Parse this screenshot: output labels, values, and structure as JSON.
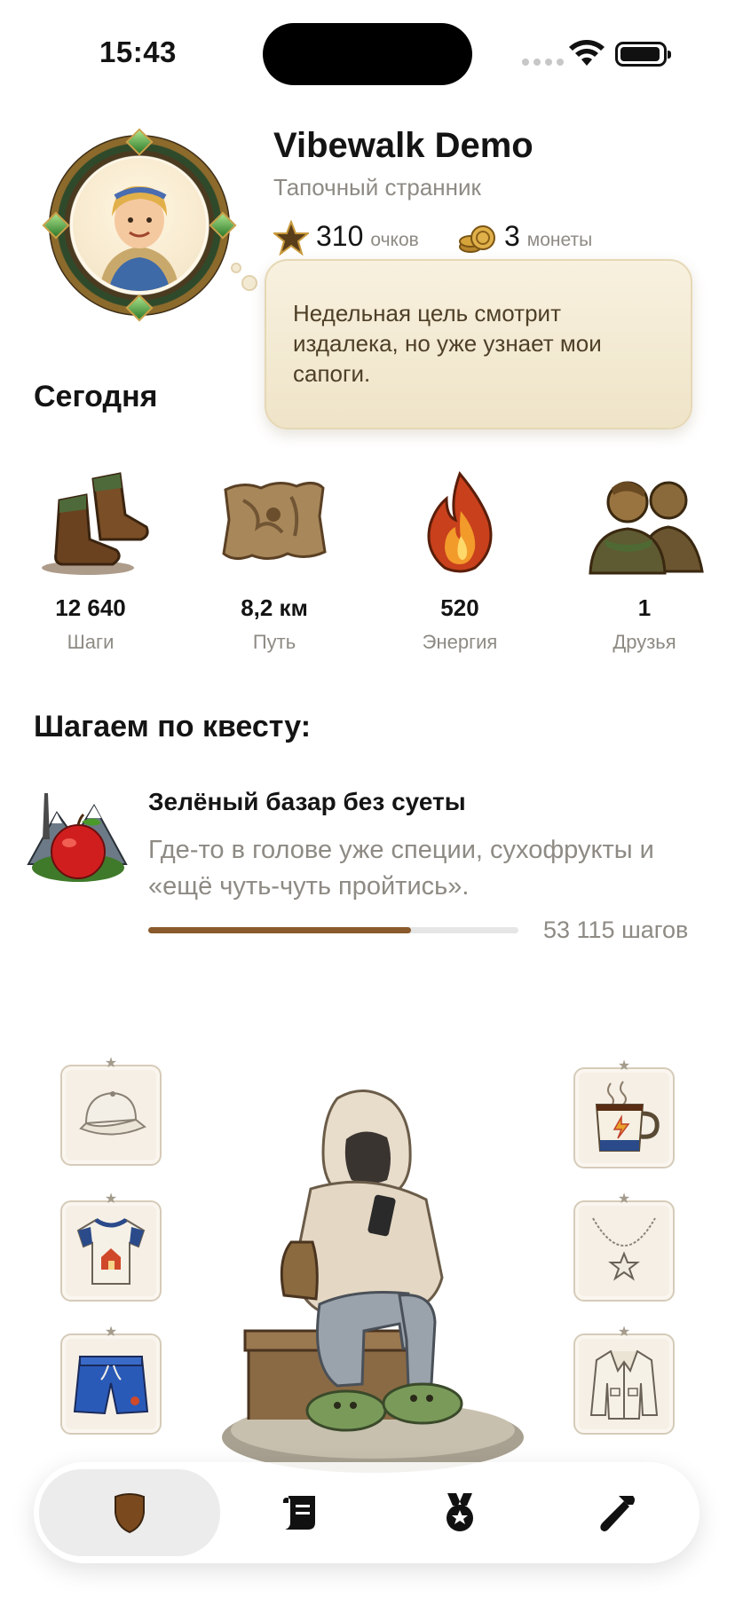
{
  "status_bar": {
    "time": "15:43"
  },
  "profile": {
    "name": "Vibewalk Demo",
    "title": "Тапочный странник",
    "points": "310",
    "points_unit": "очков",
    "coins": "3",
    "coins_unit": "монеты",
    "avatar_icon": "hero-portrait-icon"
  },
  "speech_bubble": {
    "text": "Недельная цель смотрит издалека, но уже узнает мои сапоги."
  },
  "today": {
    "title": "Сегодня",
    "stats": [
      {
        "value": "12 640",
        "label": "Шаги",
        "icon": "boots-icon"
      },
      {
        "value": "8,2 км",
        "label": "Путь",
        "icon": "map-icon"
      },
      {
        "value": "520",
        "label": "Энергия",
        "icon": "flame-icon"
      },
      {
        "value": "1",
        "label": "Друзья",
        "icon": "friends-icon"
      }
    ]
  },
  "quest": {
    "heading": "Шагаем по квесту:",
    "title": "Зелёный базар без суеты",
    "description": "Где-то в голове уже специи, сухофрукты и «ещё чуть-чуть пройтись».",
    "steps": "53 115 шагов",
    "progress": 0.71,
    "icon": "apple-mountain-icon"
  },
  "equipment": {
    "left": [
      {
        "name": "cap-icon"
      },
      {
        "name": "tshirt-icon"
      },
      {
        "name": "shorts-icon"
      }
    ],
    "right": [
      {
        "name": "coffee-mug-icon"
      },
      {
        "name": "star-necklace-icon"
      },
      {
        "name": "jacket-icon"
      }
    ],
    "hero_icon": "hooded-walker-icon"
  },
  "tab_bar": {
    "tabs": [
      {
        "icon": "shield-icon",
        "active": true
      },
      {
        "icon": "scroll-icon",
        "active": false
      },
      {
        "icon": "medal-icon",
        "active": false
      },
      {
        "icon": "hammer-icon",
        "active": false
      }
    ]
  },
  "colors": {
    "accent": "#8a5a2c",
    "text_secondary": "#8e8a84",
    "bubble": "#f4ecd8"
  }
}
